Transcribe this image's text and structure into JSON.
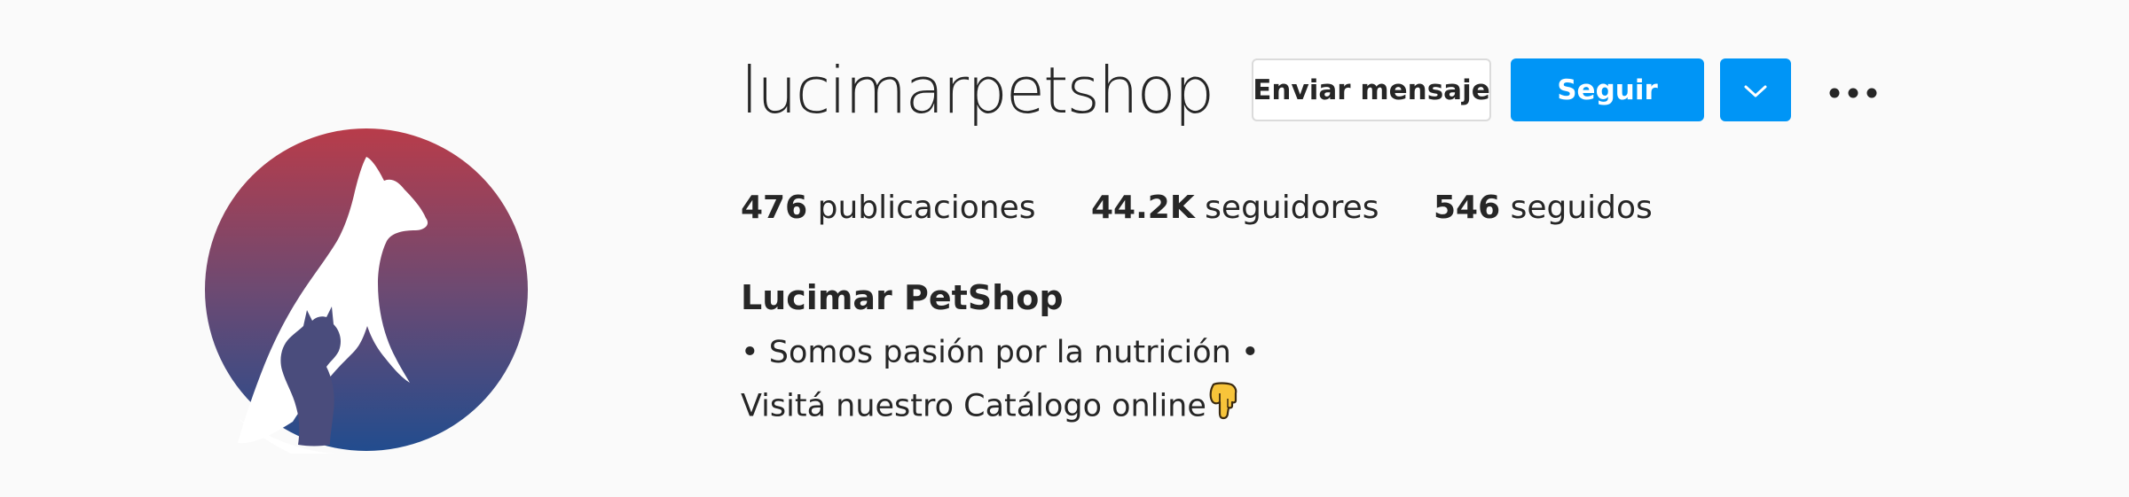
{
  "profile": {
    "username": "lucimarpetshop",
    "avatar_alt": "logo",
    "display_name": "Lucimar PetShop",
    "bio_lines": [
      "• Somos pasión por la nutrición •",
      "Visitá nuestro Catálogo online"
    ],
    "bio_emoji": "backhand-index-pointing-down"
  },
  "actions": {
    "message_label": "Enviar mensaje",
    "follow_label": "Seguir",
    "dropdown_icon": "chevron-down-icon",
    "more_icon": "more-options-icon"
  },
  "stats": [
    {
      "value": "476",
      "label": "publicaciones"
    },
    {
      "value": "44.2K",
      "label": "seguidores"
    },
    {
      "value": "546",
      "label": "seguidos"
    }
  ],
  "colors": {
    "accent": "#0095f6",
    "avatar_gradient_top": "#b43c4c",
    "avatar_gradient_bottom": "#234a8c",
    "text": "#262626"
  }
}
